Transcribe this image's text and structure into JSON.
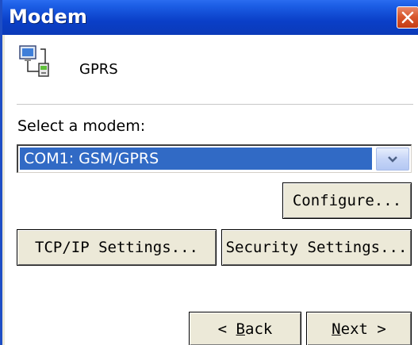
{
  "window": {
    "title": "Modem"
  },
  "connection": {
    "name": "GPRS",
    "icon": "network-connection-icon"
  },
  "modem_select": {
    "label": "Select a modem:",
    "selected_value": "COM1: GSM/GPRS"
  },
  "buttons": {
    "configure": "Configure...",
    "tcpip": "TCP/IP Settings...",
    "security": "Security Settings...",
    "back_prefix": "< ",
    "back_accel": "B",
    "back_rest": "ack",
    "next_accel": "N",
    "next_rest": "ext >"
  },
  "colors": {
    "titlebar": "#0a3fc8",
    "selection": "#316ac5",
    "close": "#d9582e"
  }
}
